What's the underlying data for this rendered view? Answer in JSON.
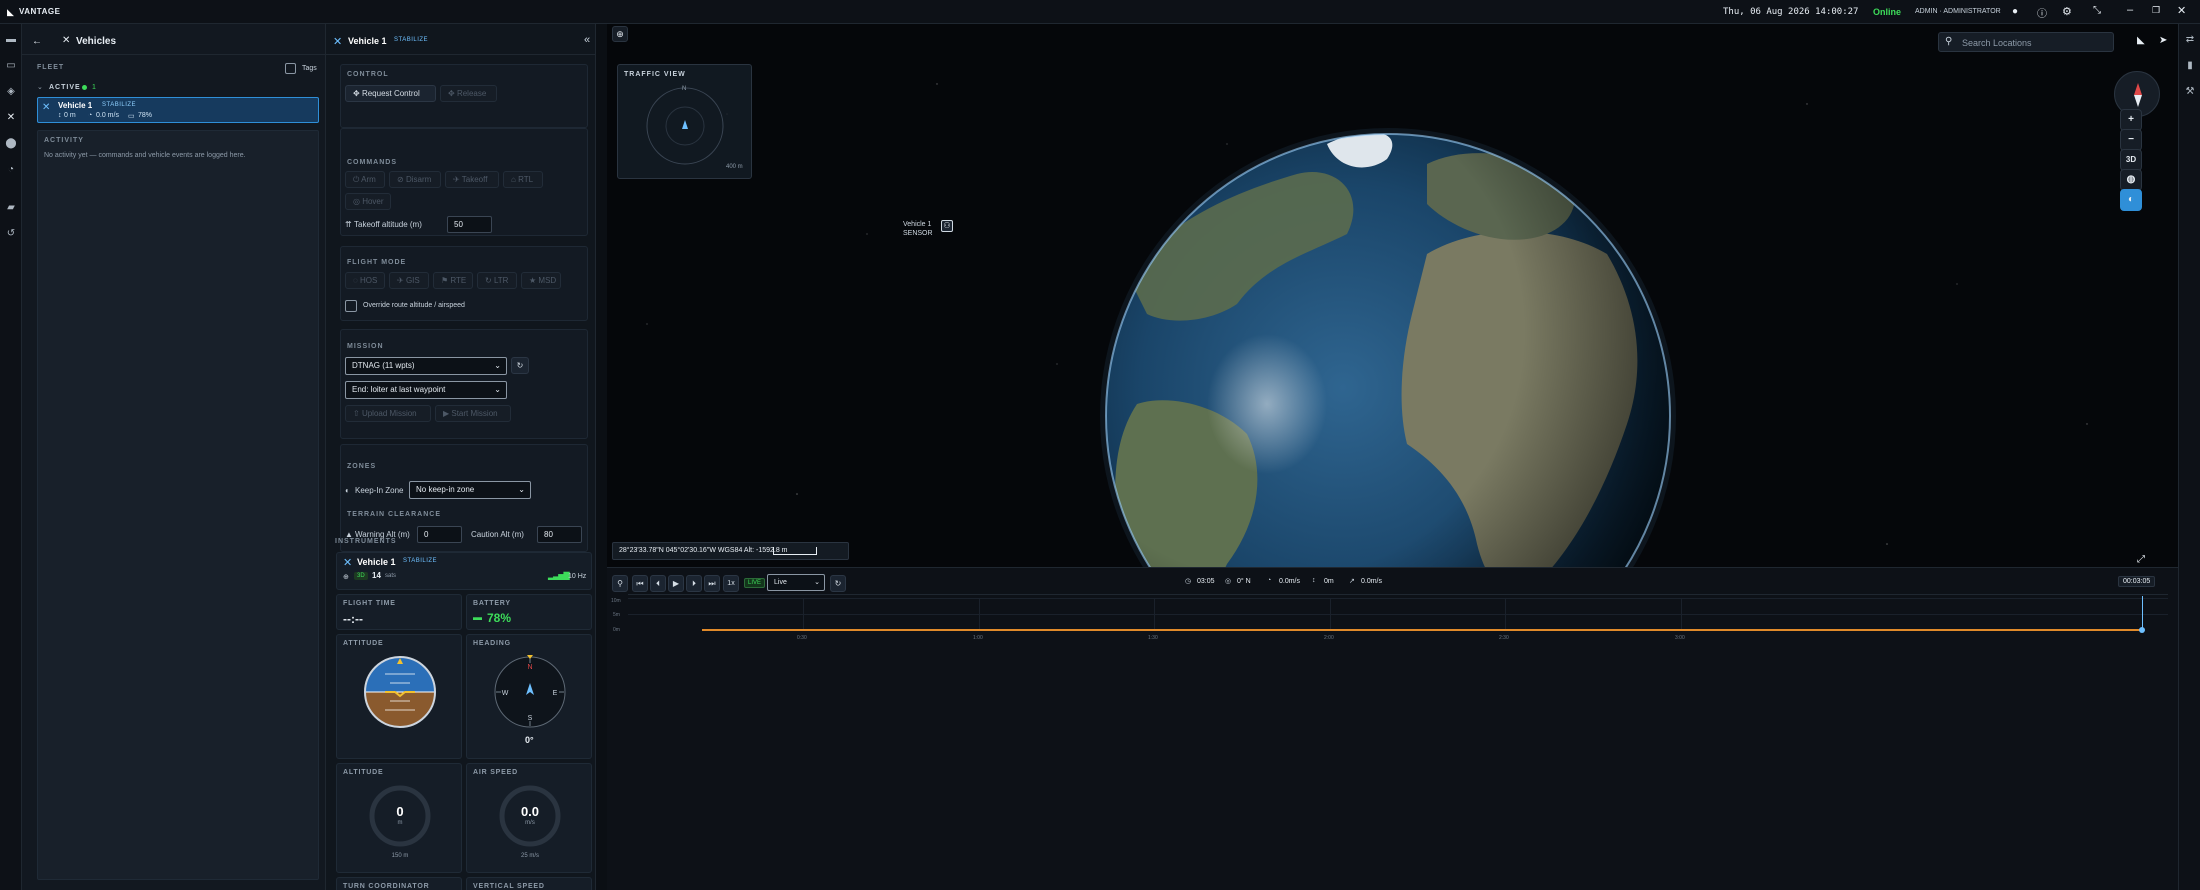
{
  "app": {
    "name": "VANTAGE"
  },
  "topbar": {
    "datetime": "Thu, 06 Aug 2026 14:00:27",
    "status": "Online",
    "user": "ADMIN · ADMINISTRATOR"
  },
  "colors": {
    "accent": "#2f8fd8",
    "online": "#3ddc5a",
    "battery": "#3ddc5a",
    "timeline": "#e08a2a"
  },
  "vehicles_panel": {
    "title": "Vehicles",
    "fleet_label": "FLEET",
    "tags_label": "Tags",
    "active_label": "ACTIVE",
    "active_count": "1",
    "vehicle": {
      "name": "Vehicle 1",
      "mode": "STABILIZE",
      "alt": "0 m",
      "speed": "0.0 m/s",
      "battery": "78%"
    },
    "activity_label": "ACTIVITY",
    "activity_empty": "No activity yet — commands and vehicle events are logged here."
  },
  "control_panel": {
    "vehicle_name": "Vehicle 1",
    "vehicle_mode": "STABILIZE",
    "control_label": "CONTROL",
    "request_control": "Request Control",
    "release": "Release",
    "commands_label": "COMMANDS",
    "commands": [
      "Arm",
      "Disarm",
      "Takeoff",
      "RTL",
      "Hover"
    ],
    "takeoff_alt_label": "Takeoff altitude (m)",
    "takeoff_alt_value": "50",
    "flight_mode_label": "FLIGHT MODE",
    "flight_modes": [
      "HOS",
      "GIS",
      "RTE",
      "LTR",
      "MSD"
    ],
    "override_label": "Override route altitude / airspeed",
    "mission_label": "MISSION",
    "mission_select": "DTNAG (11 wpts)",
    "end_select": "End: loiter at last waypoint",
    "upload_mission": "Upload Mission",
    "start_mission": "Start Mission",
    "zones_label": "ZONES",
    "keep_in_label": "Keep-In Zone",
    "keep_in_select": "No keep-in zone",
    "terrain_label": "TERRAIN CLEARANCE",
    "warning_alt_label": "Warning Alt (m)",
    "warning_alt_value": "0",
    "caution_alt_label": "Caution Alt (m)",
    "caution_alt_value": "80",
    "instruments_label": "INSTRUMENTS",
    "inst_vehicle": "Vehicle 1",
    "inst_mode": "STABILIZE",
    "gps_fix": "3D",
    "sats": "14",
    "sats_label": "sats",
    "rate": "10 Hz",
    "flight_time_label": "FLIGHT TIME",
    "flight_time": "--:--",
    "battery_label": "BATTERY",
    "battery_value": "78%",
    "attitude_label": "ATTITUDE",
    "heading_label": "HEADING",
    "heading_value": "0°",
    "altitude_label": "ALTITUDE",
    "altitude_value": "0",
    "altitude_unit": "m",
    "altitude_max": "150 m",
    "airspeed_label": "AIR SPEED",
    "airspeed_value": "0.0",
    "airspeed_unit": "m/s",
    "airspeed_max": "25 m/s",
    "turn_label": "TURN COORDINATOR",
    "vspeed_label": "VERTICAL SPEED"
  },
  "map": {
    "traffic_title": "TRAFFIC VIEW",
    "traffic_range": "400 m",
    "traffic_north": "N",
    "search_placeholder": "Search Locations",
    "vehicle_tag_line1": "Vehicle 1",
    "vehicle_tag_line2": "SENSOR",
    "coords": "28°23'33.78\"N 045°02'30.16\"W WGS84 Alt: -1592.8 m",
    "zoom_in": "+",
    "zoom_out": "−",
    "btn_3d": "3D"
  },
  "timeline": {
    "speed": "1x",
    "live_badge": "LIVE",
    "live_select": "Live",
    "stats": [
      {
        "icon": "clock-icon",
        "value": "03:05"
      },
      {
        "icon": "compass-icon",
        "value": "0° N"
      },
      {
        "icon": "speed-icon",
        "value": "0.0m/s"
      },
      {
        "icon": "altitude-icon",
        "value": "0m"
      },
      {
        "icon": "vspeed-icon",
        "value": "0.0m/s"
      }
    ],
    "elapsed": "00:03:05",
    "y_ticks": [
      "10m",
      "5m",
      "0m"
    ],
    "x_ticks": [
      "0:30",
      "1:00",
      "1:30",
      "2:00",
      "2:30",
      "3:00"
    ]
  }
}
